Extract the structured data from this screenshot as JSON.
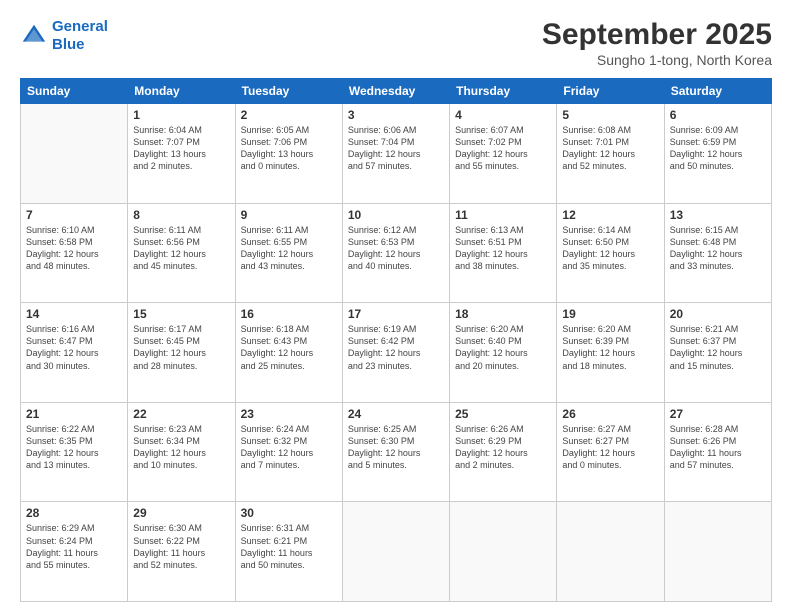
{
  "logo": {
    "line1": "General",
    "line2": "Blue"
  },
  "title": "September 2025",
  "subtitle": "Sungho 1-tong, North Korea",
  "weekdays": [
    "Sunday",
    "Monday",
    "Tuesday",
    "Wednesday",
    "Thursday",
    "Friday",
    "Saturday"
  ],
  "weeks": [
    [
      {
        "day": "",
        "info": ""
      },
      {
        "day": "1",
        "info": "Sunrise: 6:04 AM\nSunset: 7:07 PM\nDaylight: 13 hours\nand 2 minutes."
      },
      {
        "day": "2",
        "info": "Sunrise: 6:05 AM\nSunset: 7:06 PM\nDaylight: 13 hours\nand 0 minutes."
      },
      {
        "day": "3",
        "info": "Sunrise: 6:06 AM\nSunset: 7:04 PM\nDaylight: 12 hours\nand 57 minutes."
      },
      {
        "day": "4",
        "info": "Sunrise: 6:07 AM\nSunset: 7:02 PM\nDaylight: 12 hours\nand 55 minutes."
      },
      {
        "day": "5",
        "info": "Sunrise: 6:08 AM\nSunset: 7:01 PM\nDaylight: 12 hours\nand 52 minutes."
      },
      {
        "day": "6",
        "info": "Sunrise: 6:09 AM\nSunset: 6:59 PM\nDaylight: 12 hours\nand 50 minutes."
      }
    ],
    [
      {
        "day": "7",
        "info": "Sunrise: 6:10 AM\nSunset: 6:58 PM\nDaylight: 12 hours\nand 48 minutes."
      },
      {
        "day": "8",
        "info": "Sunrise: 6:11 AM\nSunset: 6:56 PM\nDaylight: 12 hours\nand 45 minutes."
      },
      {
        "day": "9",
        "info": "Sunrise: 6:11 AM\nSunset: 6:55 PM\nDaylight: 12 hours\nand 43 minutes."
      },
      {
        "day": "10",
        "info": "Sunrise: 6:12 AM\nSunset: 6:53 PM\nDaylight: 12 hours\nand 40 minutes."
      },
      {
        "day": "11",
        "info": "Sunrise: 6:13 AM\nSunset: 6:51 PM\nDaylight: 12 hours\nand 38 minutes."
      },
      {
        "day": "12",
        "info": "Sunrise: 6:14 AM\nSunset: 6:50 PM\nDaylight: 12 hours\nand 35 minutes."
      },
      {
        "day": "13",
        "info": "Sunrise: 6:15 AM\nSunset: 6:48 PM\nDaylight: 12 hours\nand 33 minutes."
      }
    ],
    [
      {
        "day": "14",
        "info": "Sunrise: 6:16 AM\nSunset: 6:47 PM\nDaylight: 12 hours\nand 30 minutes."
      },
      {
        "day": "15",
        "info": "Sunrise: 6:17 AM\nSunset: 6:45 PM\nDaylight: 12 hours\nand 28 minutes."
      },
      {
        "day": "16",
        "info": "Sunrise: 6:18 AM\nSunset: 6:43 PM\nDaylight: 12 hours\nand 25 minutes."
      },
      {
        "day": "17",
        "info": "Sunrise: 6:19 AM\nSunset: 6:42 PM\nDaylight: 12 hours\nand 23 minutes."
      },
      {
        "day": "18",
        "info": "Sunrise: 6:20 AM\nSunset: 6:40 PM\nDaylight: 12 hours\nand 20 minutes."
      },
      {
        "day": "19",
        "info": "Sunrise: 6:20 AM\nSunset: 6:39 PM\nDaylight: 12 hours\nand 18 minutes."
      },
      {
        "day": "20",
        "info": "Sunrise: 6:21 AM\nSunset: 6:37 PM\nDaylight: 12 hours\nand 15 minutes."
      }
    ],
    [
      {
        "day": "21",
        "info": "Sunrise: 6:22 AM\nSunset: 6:35 PM\nDaylight: 12 hours\nand 13 minutes."
      },
      {
        "day": "22",
        "info": "Sunrise: 6:23 AM\nSunset: 6:34 PM\nDaylight: 12 hours\nand 10 minutes."
      },
      {
        "day": "23",
        "info": "Sunrise: 6:24 AM\nSunset: 6:32 PM\nDaylight: 12 hours\nand 7 minutes."
      },
      {
        "day": "24",
        "info": "Sunrise: 6:25 AM\nSunset: 6:30 PM\nDaylight: 12 hours\nand 5 minutes."
      },
      {
        "day": "25",
        "info": "Sunrise: 6:26 AM\nSunset: 6:29 PM\nDaylight: 12 hours\nand 2 minutes."
      },
      {
        "day": "26",
        "info": "Sunrise: 6:27 AM\nSunset: 6:27 PM\nDaylight: 12 hours\nand 0 minutes."
      },
      {
        "day": "27",
        "info": "Sunrise: 6:28 AM\nSunset: 6:26 PM\nDaylight: 11 hours\nand 57 minutes."
      }
    ],
    [
      {
        "day": "28",
        "info": "Sunrise: 6:29 AM\nSunset: 6:24 PM\nDaylight: 11 hours\nand 55 minutes."
      },
      {
        "day": "29",
        "info": "Sunrise: 6:30 AM\nSunset: 6:22 PM\nDaylight: 11 hours\nand 52 minutes."
      },
      {
        "day": "30",
        "info": "Sunrise: 6:31 AM\nSunset: 6:21 PM\nDaylight: 11 hours\nand 50 minutes."
      },
      {
        "day": "",
        "info": ""
      },
      {
        "day": "",
        "info": ""
      },
      {
        "day": "",
        "info": ""
      },
      {
        "day": "",
        "info": ""
      }
    ]
  ]
}
